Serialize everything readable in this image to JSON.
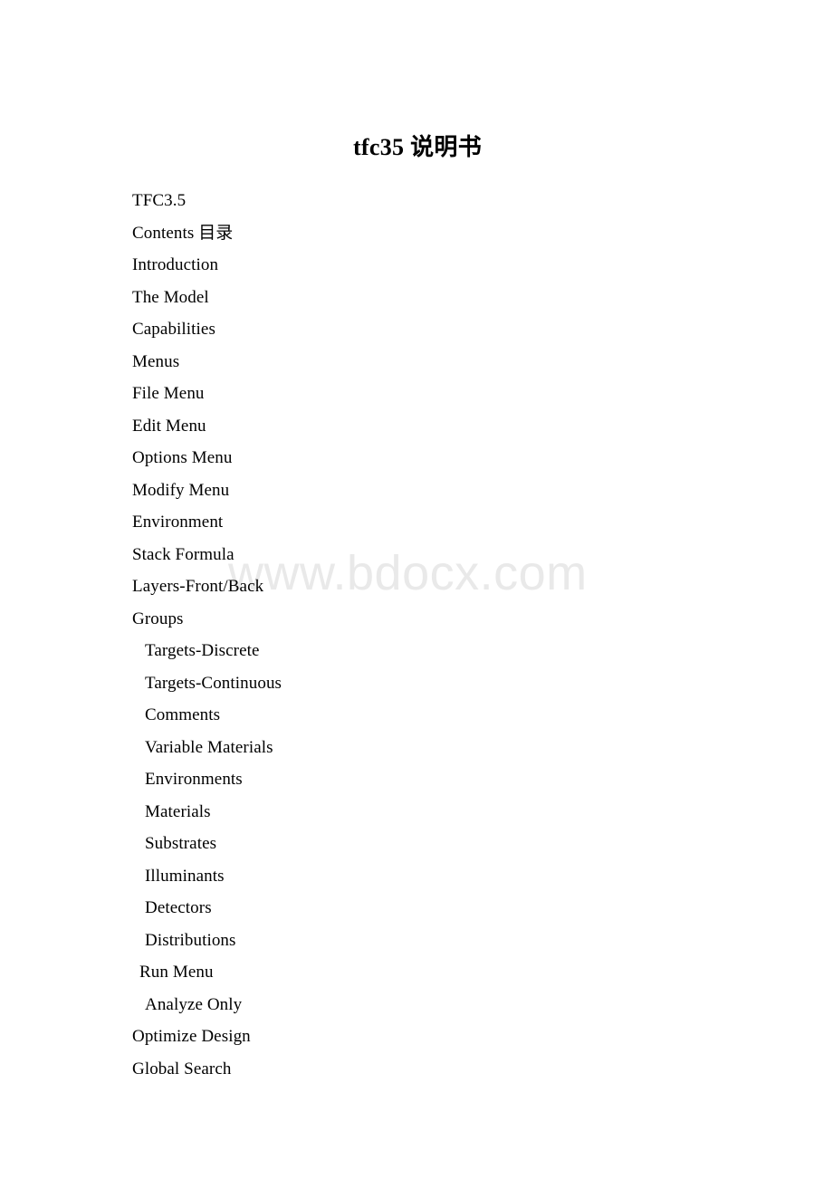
{
  "document": {
    "title": "tfc35 说明书",
    "watermark": "www.bdocx.com",
    "watermark_color": "#e9e9e9",
    "text_color": "#000000",
    "background_color": "#ffffff"
  },
  "toc": {
    "entries": [
      {
        "label": "TFC3.5",
        "level": 0
      },
      {
        "label": "Contents 目录",
        "level": 0
      },
      {
        "label": "Introduction",
        "level": 0
      },
      {
        "label": "The Model",
        "level": 0
      },
      {
        "label": "Capabilities",
        "level": 0
      },
      {
        "label": "Menus",
        "level": 0
      },
      {
        "label": "File Menu",
        "level": 0
      },
      {
        "label": "Edit Menu",
        "level": 0
      },
      {
        "label": "Options Menu",
        "level": 0
      },
      {
        "label": "Modify Menu",
        "level": 0
      },
      {
        "label": "Environment",
        "level": 0
      },
      {
        "label": "Stack Formula",
        "level": 0
      },
      {
        "label": "Layers-Front/Back",
        "level": 0
      },
      {
        "label": "Groups",
        "level": 0
      },
      {
        "label": "Targets-Discrete",
        "level": 1
      },
      {
        "label": "Targets-Continuous",
        "level": 1
      },
      {
        "label": "Comments",
        "level": 1
      },
      {
        "label": "Variable Materials",
        "level": 1
      },
      {
        "label": "Environments",
        "level": 1
      },
      {
        "label": "Materials",
        "level": 1
      },
      {
        "label": "Substrates",
        "level": 1
      },
      {
        "label": "Illuminants",
        "level": 1
      },
      {
        "label": "Detectors",
        "level": 1
      },
      {
        "label": "Distributions",
        "level": 1
      },
      {
        "label": "Run Menu",
        "level": 2
      },
      {
        "label": "Analyze Only",
        "level": 1
      },
      {
        "label": "Optimize Design",
        "level": 0
      },
      {
        "label": "Global Search",
        "level": 0
      }
    ]
  }
}
